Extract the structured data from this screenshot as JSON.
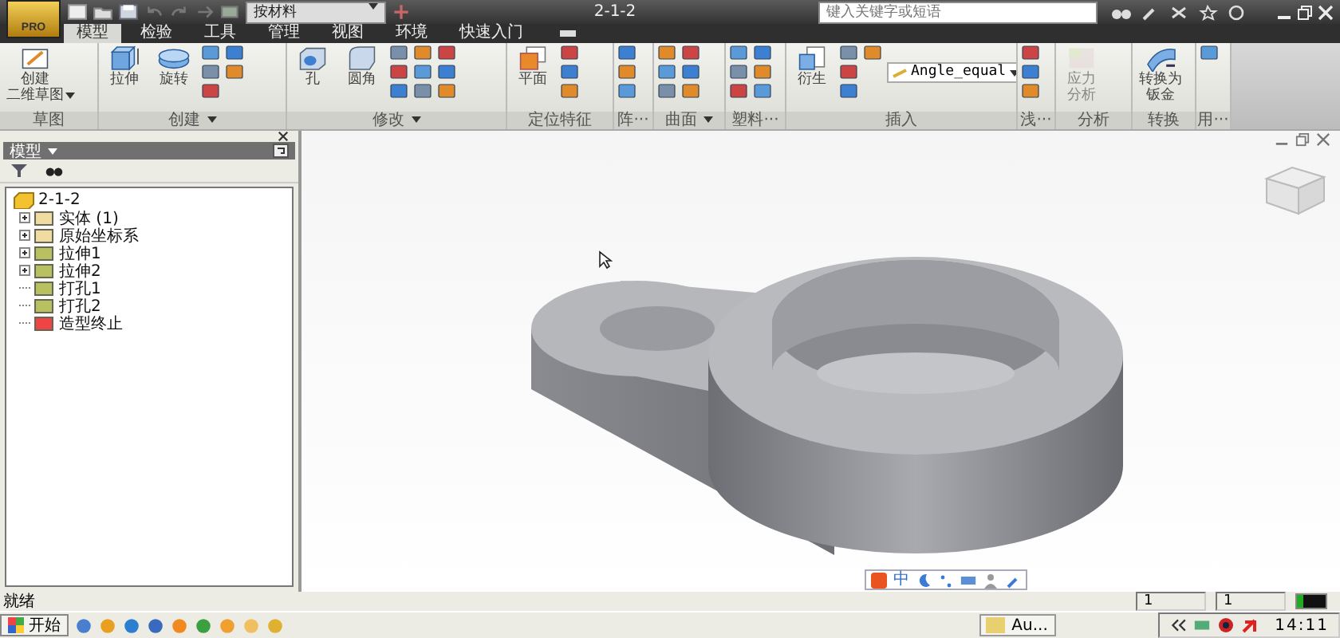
{
  "title_bar": {
    "app_label": "PRO",
    "material": "按材料",
    "title": "2-1-2",
    "search": {
      "placeholder": "键入关键字或短语"
    }
  },
  "tabs": [
    {
      "label": "模型",
      "selected": true
    },
    {
      "label": "检验",
      "selected": false
    },
    {
      "label": "工具",
      "selected": false
    },
    {
      "label": "管理",
      "selected": false
    },
    {
      "label": "视图",
      "selected": false
    },
    {
      "label": "环境",
      "selected": false
    },
    {
      "label": "快速入门",
      "selected": false
    }
  ],
  "ribbon": {
    "panels": [
      {
        "label": "草图",
        "has_menu": false,
        "buttons": [
          {
            "lines": [
              "创建",
              "二维草图"
            ],
            "has_menu": true,
            "disabled": false
          }
        ]
      },
      {
        "label": "创建",
        "has_menu": true,
        "buttons": [
          {
            "lines": [
              "拉伸"
            ],
            "has_menu": false,
            "disabled": false
          },
          {
            "lines": [
              "旋转"
            ],
            "has_menu": false,
            "disabled": false
          }
        ]
      },
      {
        "label": "修改",
        "has_menu": true,
        "buttons": [
          {
            "lines": [
              "孔"
            ],
            "has_menu": false,
            "disabled": false
          },
          {
            "lines": [
              "圆角"
            ],
            "has_menu": false,
            "disabled": false
          }
        ]
      },
      {
        "label": "定位特征",
        "has_menu": false,
        "buttons": [
          {
            "lines": [
              "平面"
            ],
            "has_menu": false,
            "disabled": false
          }
        ]
      },
      {
        "label": "阵···",
        "has_menu": false
      },
      {
        "label": "曲面",
        "has_menu": true
      },
      {
        "label": "塑料···",
        "has_menu": false
      },
      {
        "label": "插入",
        "has_menu": false,
        "dropdown": "Angle_equal",
        "buttons": [
          {
            "lines": [
              "衍生"
            ],
            "has_menu": false,
            "disabled": false
          }
        ]
      },
      {
        "label": "浅···",
        "has_menu": false
      },
      {
        "label": "分析",
        "has_menu": false,
        "buttons": [
          {
            "lines": [
              "应力",
              "分析"
            ],
            "has_menu": false,
            "disabled": true
          }
        ]
      },
      {
        "label": "转换",
        "has_menu": false,
        "buttons": [
          {
            "lines": [
              "转换为",
              "钣金"
            ],
            "has_menu": false,
            "disabled": false
          }
        ]
      },
      {
        "label": "用···",
        "has_menu": false
      }
    ]
  },
  "browser": {
    "title": "模型",
    "root": {
      "label": "2-1-2",
      "children": [
        {
          "label": "实体 (1)",
          "expandable": true
        },
        {
          "label": "原始坐标系",
          "expandable": true
        },
        {
          "label": "拉伸1",
          "expandable": true
        },
        {
          "label": "拉伸2",
          "expandable": true
        },
        {
          "label": "打孔1",
          "expandable": false
        },
        {
          "label": "打孔2",
          "expandable": false
        },
        {
          "label": "造型终止",
          "expandable": false
        }
      ]
    }
  },
  "ime_bar": {
    "mode": "中"
  },
  "status_bar": {
    "text": "就绪",
    "fields": [
      "1",
      "1"
    ]
  },
  "taskbar": {
    "start": "开始",
    "tasks": [
      {
        "label": "Au..."
      }
    ],
    "clock": "14:11"
  }
}
